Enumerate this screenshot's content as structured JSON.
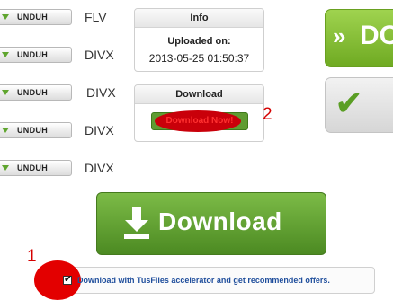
{
  "unduh_rows": [
    {
      "button": "UNDUH",
      "format": "FLV"
    },
    {
      "button": "UNDUH",
      "format": "DIVX"
    },
    {
      "button": "UNDUH",
      "format": "DIVX"
    },
    {
      "button": "UNDUH",
      "format": "DIVX"
    },
    {
      "button": "UNDUH",
      "format": "DIVX"
    }
  ],
  "info_panel": {
    "title": "Info",
    "label": "Uploaded on:",
    "value": "2013-05-25 01:50:37"
  },
  "download_panel": {
    "title": "Download",
    "button": "Download Now!"
  },
  "annotations": {
    "one": "1",
    "two": "2"
  },
  "right_buttons": {
    "green_text": "DO",
    "green_icon": "double-chevron-down-icon",
    "gray_icon": "checkmark-icon"
  },
  "big_download": {
    "label": "Download",
    "icon": "download-arrow-icon"
  },
  "accelerator": {
    "text": "Download with TusFiles accelerator and get recommended offers.",
    "checked": true
  },
  "colors": {
    "green": "#6faa22",
    "red": "#d50000",
    "link_blue": "#1f4e9c"
  }
}
